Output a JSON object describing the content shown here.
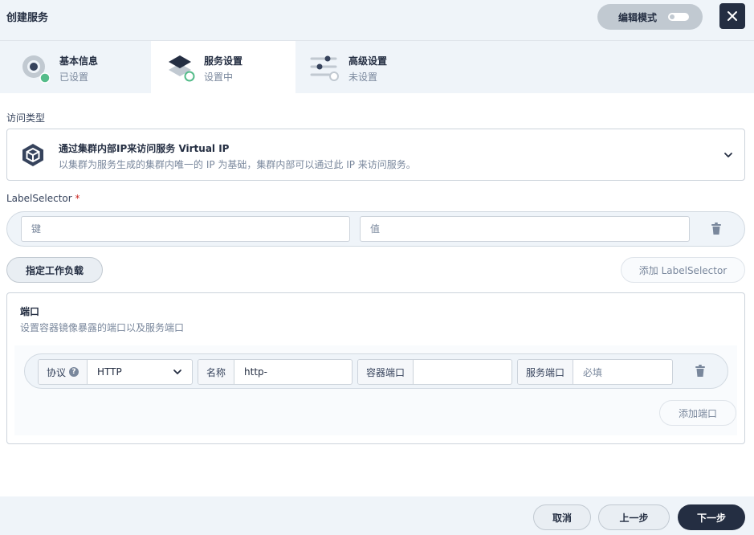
{
  "header": {
    "title": "创建服务",
    "edit_mode_label": "编辑模式"
  },
  "steps": [
    {
      "title": "基本信息",
      "status": "已设置"
    },
    {
      "title": "服务设置",
      "status": "设置中"
    },
    {
      "title": "高级设置",
      "status": "未设置"
    }
  ],
  "access": {
    "section_label": "访问类型",
    "title": "通过集群内部IP来访问服务 Virtual IP",
    "description": "以集群为服务生成的集群内唯一的 IP 为基础，集群内部可以通过此 IP 来访问服务。"
  },
  "label_selector": {
    "section_label": "LabelSelector",
    "required_mark": "*",
    "key_placeholder": "键",
    "value_placeholder": "值",
    "specify_workload_button": "指定工作负载",
    "add_button": "添加 LabelSelector"
  },
  "ports": {
    "title": "端口",
    "description": "设置容器镜像暴露的端口以及服务端口",
    "protocol_label": "协议",
    "protocol_help": "?",
    "protocol_value": "HTTP",
    "name_label": "名称",
    "name_value": "http-",
    "container_port_label": "容器端口",
    "container_port_value": "",
    "service_port_label": "服务端口",
    "service_port_placeholder": "必填",
    "add_port_button": "添加端口"
  },
  "footer": {
    "cancel": "取消",
    "prev": "上一步",
    "next": "下一步"
  },
  "colors": {
    "accent_dark": "#242e42",
    "status_green": "#55bc8a",
    "panel_bg": "#eff4f9",
    "muted_text": "#79879c"
  }
}
